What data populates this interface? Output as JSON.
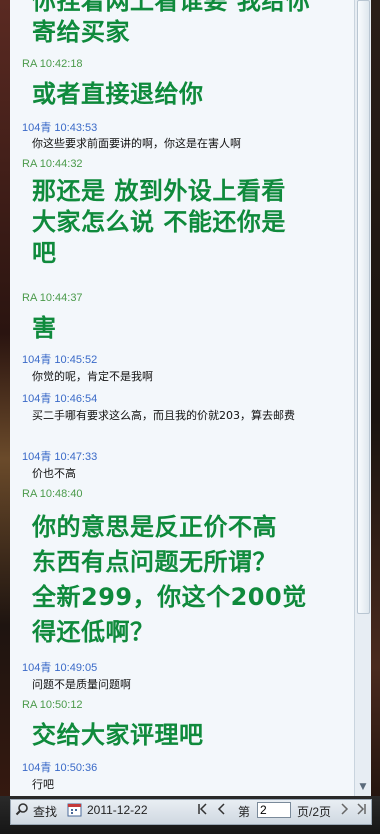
{
  "messages": [
    {
      "type": "big",
      "text": "你挂着网上看谁要 我给你寄给买家"
    },
    {
      "type": "meta",
      "who": "ra",
      "text": "RA 10:42:18"
    },
    {
      "type": "big",
      "text": "或者直接退给你"
    },
    {
      "type": "meta",
      "who": "qing",
      "text": "104青 10:43:53"
    },
    {
      "type": "small",
      "text": "你这些要求前面要讲的啊，你这是在害人啊"
    },
    {
      "type": "meta",
      "who": "ra",
      "text": "RA 10:44:32"
    },
    {
      "type": "big",
      "text": "那还是 放到外设上看看大家怎么说 不能还你是吧"
    },
    {
      "type": "meta",
      "who": "ra",
      "text": "RA 10:44:37"
    },
    {
      "type": "big",
      "text": "害"
    },
    {
      "type": "meta",
      "who": "qing",
      "text": "104青 10:45:52"
    },
    {
      "type": "small",
      "text": "你觉的呢，肯定不是我啊"
    },
    {
      "type": "meta",
      "who": "qing",
      "text": "104青 10:46:54"
    },
    {
      "type": "small",
      "text": "买二手哪有要求这么高，而且我的价就203，算去邮费"
    },
    {
      "type": "meta",
      "who": "qing",
      "text": "104青 10:47:33"
    },
    {
      "type": "small",
      "text": "价也不高"
    },
    {
      "type": "meta",
      "who": "ra",
      "text": "RA 10:48:40"
    },
    {
      "type": "big",
      "text": "你的意思是反正价不高 东西有点问题无所谓？ 全新299，你这个200觉得还低啊？"
    },
    {
      "type": "meta",
      "who": "qing",
      "text": "104青 10:49:05"
    },
    {
      "type": "small",
      "text": "问题不是质量问题啊"
    },
    {
      "type": "meta",
      "who": "ra",
      "text": "RA 10:50:12"
    },
    {
      "type": "big",
      "text": "交给大家评理吧"
    },
    {
      "type": "meta",
      "who": "qing",
      "text": "104青 10:50:36"
    },
    {
      "type": "small",
      "text": "行吧"
    }
  ],
  "toolbar": {
    "search_label": "查找",
    "date": "2011-12-22",
    "page_prefix": "第",
    "page_value": "2",
    "page_suffix": "页/2页"
  },
  "icons": {
    "search": "magnifier-icon",
    "calendar": "calendar-icon",
    "first": "first-page-icon",
    "prev": "prev-page-icon",
    "next": "next-page-icon",
    "last": "last-page-icon"
  }
}
